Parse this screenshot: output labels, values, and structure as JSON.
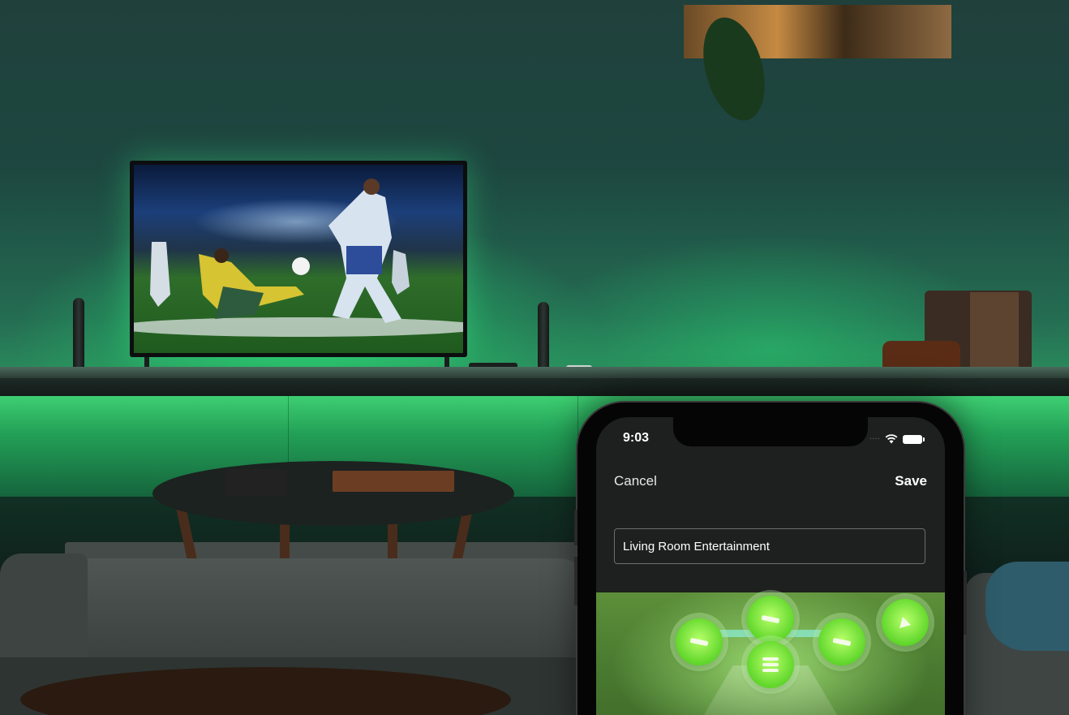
{
  "phone": {
    "status_time": "9:03",
    "signal_icon": "signal-dots-icon",
    "wifi_icon": "wifi-icon",
    "battery_icon": "battery-icon",
    "cancel_label": "Cancel",
    "save_label": "Save",
    "area_name_value": "Living Room Entertainment",
    "lights": [
      {
        "icon": "lightbar-icon"
      },
      {
        "icon": "lightbar-icon"
      },
      {
        "icon": "lightstrip-icon"
      },
      {
        "icon": "lightbar-icon"
      },
      {
        "icon": "lamp-icon"
      }
    ]
  },
  "colors": {
    "accent_light_green": "#7be23a",
    "ambient_green": "#2fd572",
    "screen_bg": "#1e1f1f"
  }
}
